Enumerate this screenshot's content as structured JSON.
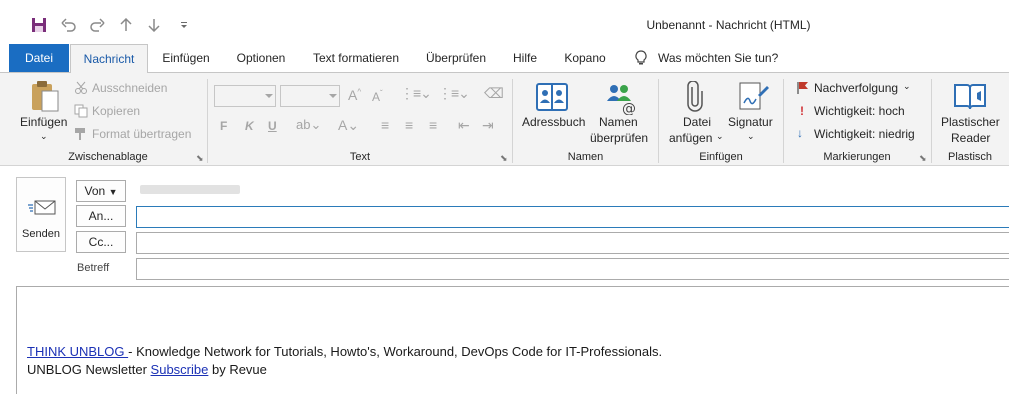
{
  "window": {
    "title": "Unbenannt  -  Nachricht (HTML)"
  },
  "quick_access": {
    "icons": [
      "save-icon",
      "undo-icon",
      "redo-icon",
      "up-arrow-icon",
      "down-arrow-icon",
      "customize-icon"
    ]
  },
  "tabs": {
    "datei": "Datei",
    "nachricht": "Nachricht",
    "einfuegen": "Einfügen",
    "optionen": "Optionen",
    "text_formatieren": "Text formatieren",
    "ueberpruefen": "Überprüfen",
    "hilfe": "Hilfe",
    "kopano": "Kopano",
    "tell_me": "Was möchten Sie tun?"
  },
  "ribbon": {
    "zwischenablage": {
      "label": "Zwischenablage",
      "paste": "Einfügen",
      "cut": "Ausschneiden",
      "copy": "Kopieren",
      "format_painter": "Format übertragen"
    },
    "text": {
      "label": "Text",
      "bold": "F",
      "italic": "K",
      "underline": "U"
    },
    "namen": {
      "label": "Namen",
      "adressbuch": "Adressbuch",
      "namen_line1": "Namen",
      "namen_line2": "überprüfen"
    },
    "einfuegen": {
      "label": "Einfügen",
      "datei_line1": "Datei",
      "datei_line2": "anfügen",
      "signatur": "Signatur"
    },
    "markierungen": {
      "label": "Markierungen",
      "nachverfolgung": "Nachverfolgung",
      "wichtigkeit_hoch": "Wichtigkeit: hoch",
      "wichtigkeit_niedrig": "Wichtigkeit: niedrig"
    },
    "plastisch": {
      "label": "Plastisch",
      "reader_line1": "Plastischer",
      "reader_line2": "Reader"
    }
  },
  "compose": {
    "send": "Senden",
    "von": "Von",
    "an": "An...",
    "cc": "Cc...",
    "betreff": "Betreff",
    "to_value": "",
    "cc_value": "",
    "subject_value": ""
  },
  "body": {
    "line1_link": "THINK UNBLOG ",
    "line1_rest": "- Knowledge Network for Tutorials, Howto's, Workaround, DevOps Code for IT-Professionals.",
    "line2_prefix": "UNBLOG Newsletter ",
    "line2_link": "Subscribe",
    "line2_suffix": " by Revue"
  },
  "colors": {
    "accent": "#1a6dc2",
    "link": "#1b31b5",
    "flag": "#c0392b",
    "importance_high": "#d13438",
    "importance_low": "#2f6fb5"
  }
}
